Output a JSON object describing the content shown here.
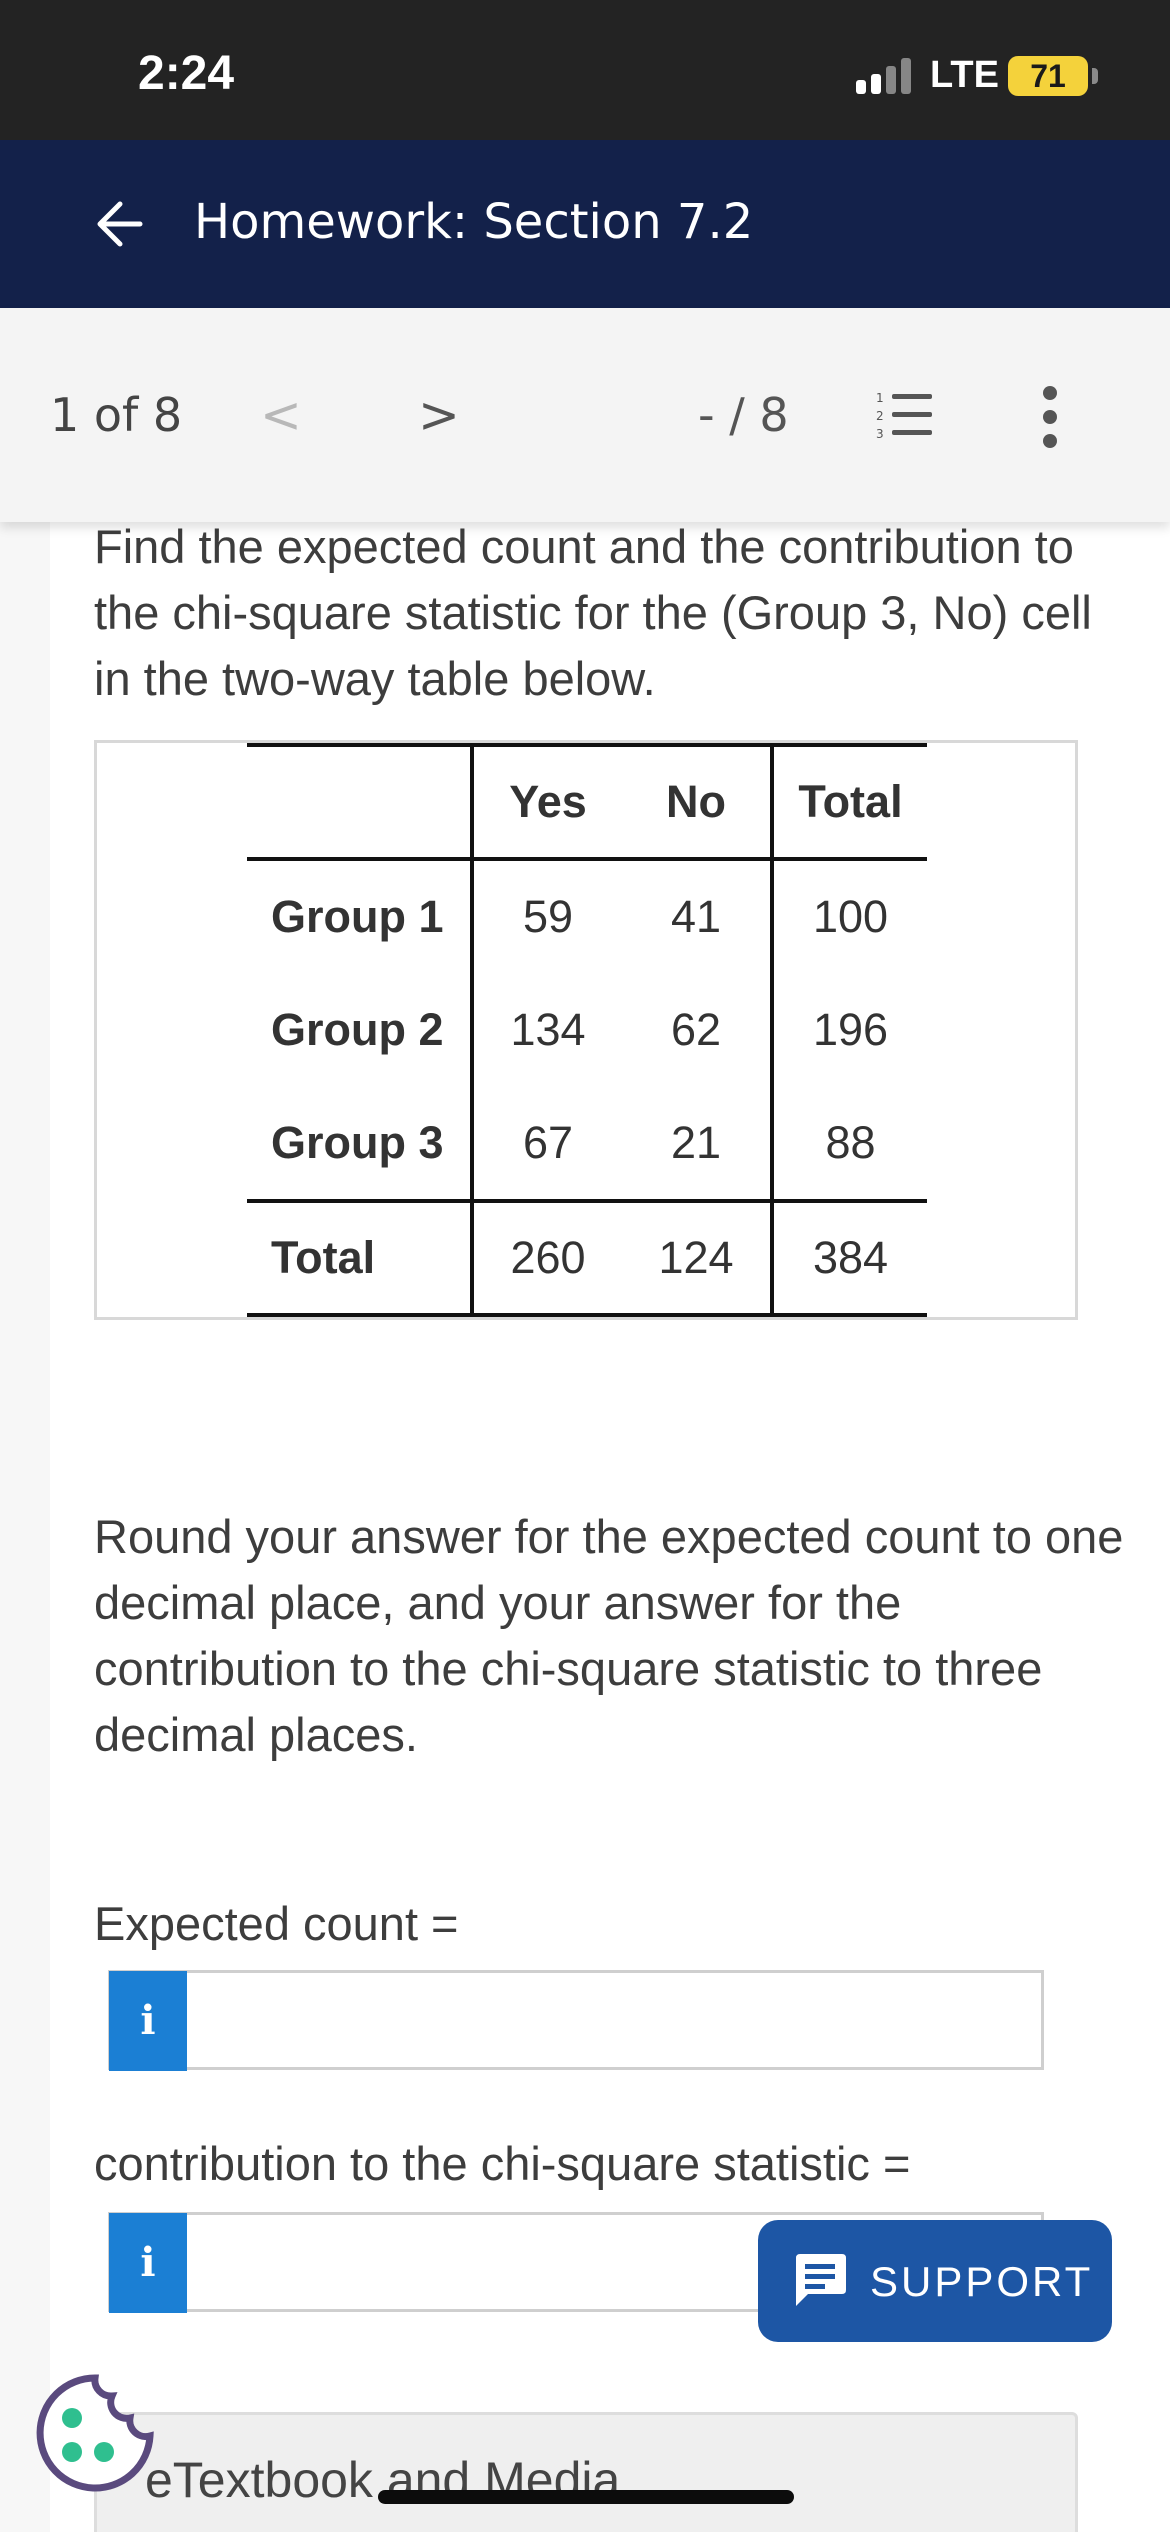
{
  "status_bar": {
    "time": "2:24",
    "network": "LTE",
    "battery": "71"
  },
  "header": {
    "title": "Homework: Section 7.2"
  },
  "nav": {
    "page_count": "1 of 8",
    "prev": "<",
    "next": ">",
    "score": "- / 8"
  },
  "question": {
    "prompt": "Find the expected count and the contribution to the chi-square statistic for the (Group 3, No) cell in the two-way table below.",
    "table": {
      "headers": [
        "",
        "Yes",
        "No",
        "Total"
      ],
      "rows": [
        {
          "label": "Group 1",
          "yes": "59",
          "no": "41",
          "total": "100"
        },
        {
          "label": "Group 2",
          "yes": "134",
          "no": "62",
          "total": "196"
        },
        {
          "label": "Group 3",
          "yes": "67",
          "no": "21",
          "total": "88"
        },
        {
          "label": "Total",
          "yes": "260",
          "no": "124",
          "total": "384"
        }
      ]
    },
    "instructions": "Round your answer for the expected count to one decimal place, and your answer for the contribution to the chi-square statistic to three decimal places.",
    "fields": [
      {
        "label": "Expected count =",
        "value": "",
        "info": "i"
      },
      {
        "label": "contribution to the chi-square statistic =",
        "value": "",
        "info": "i"
      }
    ]
  },
  "support": {
    "label": "SUPPORT"
  },
  "etextbook": {
    "label": "eTextbook and Media"
  },
  "colors": {
    "header_bg": "#13214a",
    "info_button": "#1b7fd4",
    "support_button": "#1d56a5",
    "battery": "#f4d23b",
    "cookie": "#2fbf8f"
  }
}
